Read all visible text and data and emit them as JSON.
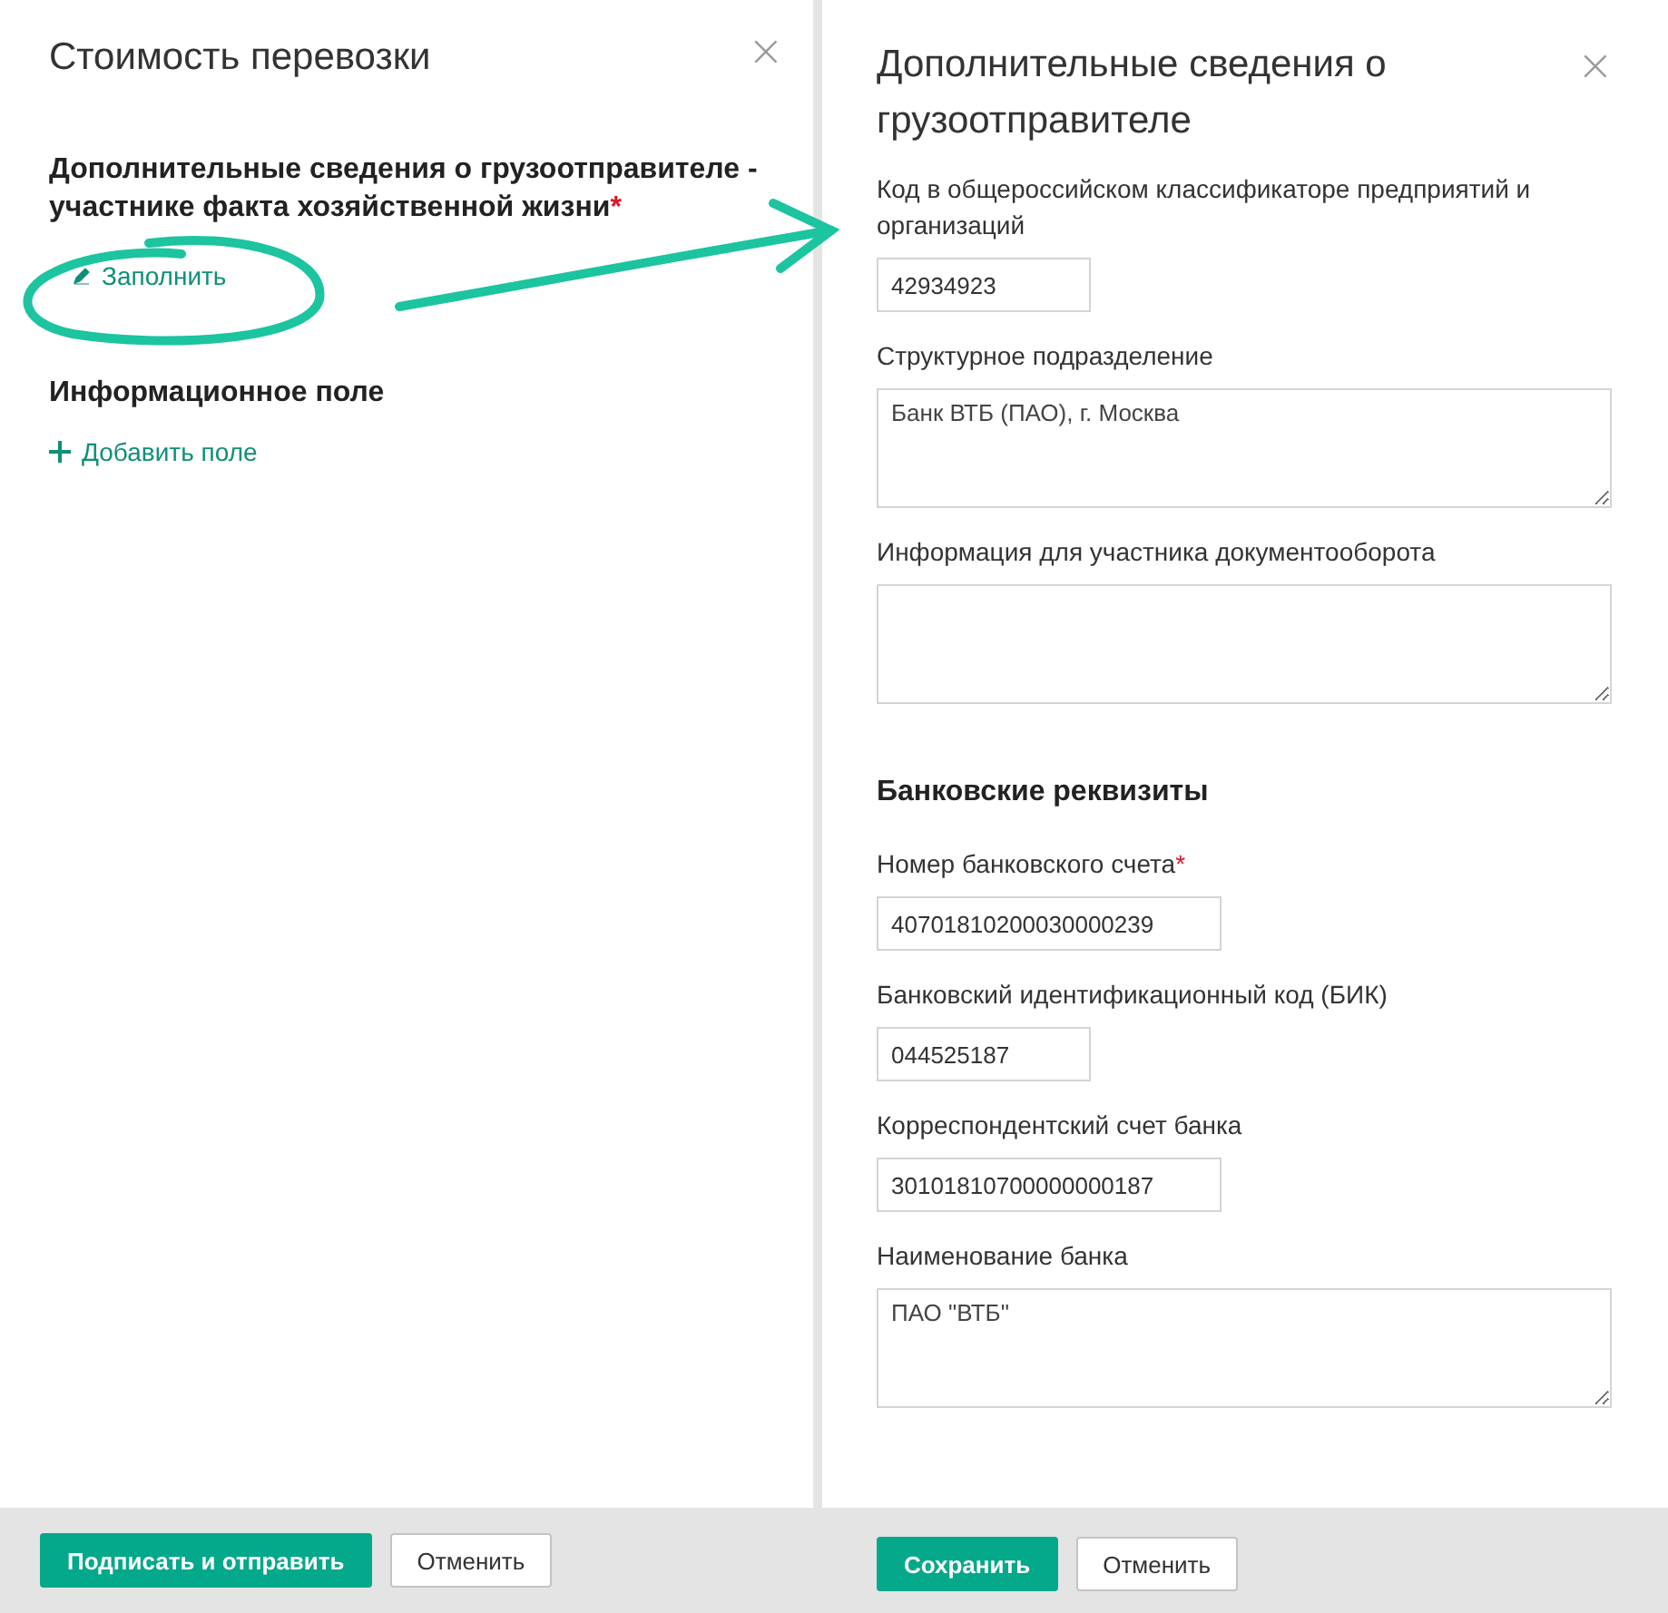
{
  "left_panel": {
    "title": "Стоимость перевозки",
    "close": "×",
    "sections": [
      {
        "heading": "Дополнительные сведения о грузоотправителе - участнике факта хозяйственной жизни",
        "required_mark": "*",
        "link": {
          "kind": "edit",
          "label": "Заполнить"
        }
      },
      {
        "heading": "Информационное поле",
        "link": {
          "kind": "add",
          "label": "Добавить поле"
        }
      }
    ],
    "buttons": [
      {
        "label": "Подписать и отправить",
        "primary": true
      },
      {
        "label": "Отменить",
        "primary": false
      }
    ]
  },
  "right_panel": {
    "title": "Дополнительные сведения о грузоотправителе",
    "close": "×",
    "items": [
      {
        "kind": "input",
        "label": "Код в общероссийском классификаторе предприятий и организаций",
        "value": "42934923"
      },
      {
        "kind": "textarea",
        "label": "Структурное подразделение",
        "value": "Банк ВТБ (ПАО), г. Москва"
      },
      {
        "kind": "textarea",
        "label": "Информация для участника документооборота",
        "value": ""
      },
      {
        "kind": "heading",
        "label": "Банковские реквизиты"
      },
      {
        "kind": "input",
        "label": "Номер банковского счета",
        "required_mark": "*",
        "value": "40701810200030000239"
      },
      {
        "kind": "input",
        "label": "Банковский идентификационный код (БИК)",
        "value": "044525187"
      },
      {
        "kind": "input",
        "label": "Корреспондентский счет банка",
        "value": "30101810700000000187"
      },
      {
        "kind": "textarea",
        "label": "Наименование банка",
        "value": "ПАО \"ВТБ\""
      }
    ],
    "buttons": [
      {
        "label": "Сохранить",
        "primary": true
      },
      {
        "label": "Отменить",
        "primary": false
      }
    ]
  }
}
